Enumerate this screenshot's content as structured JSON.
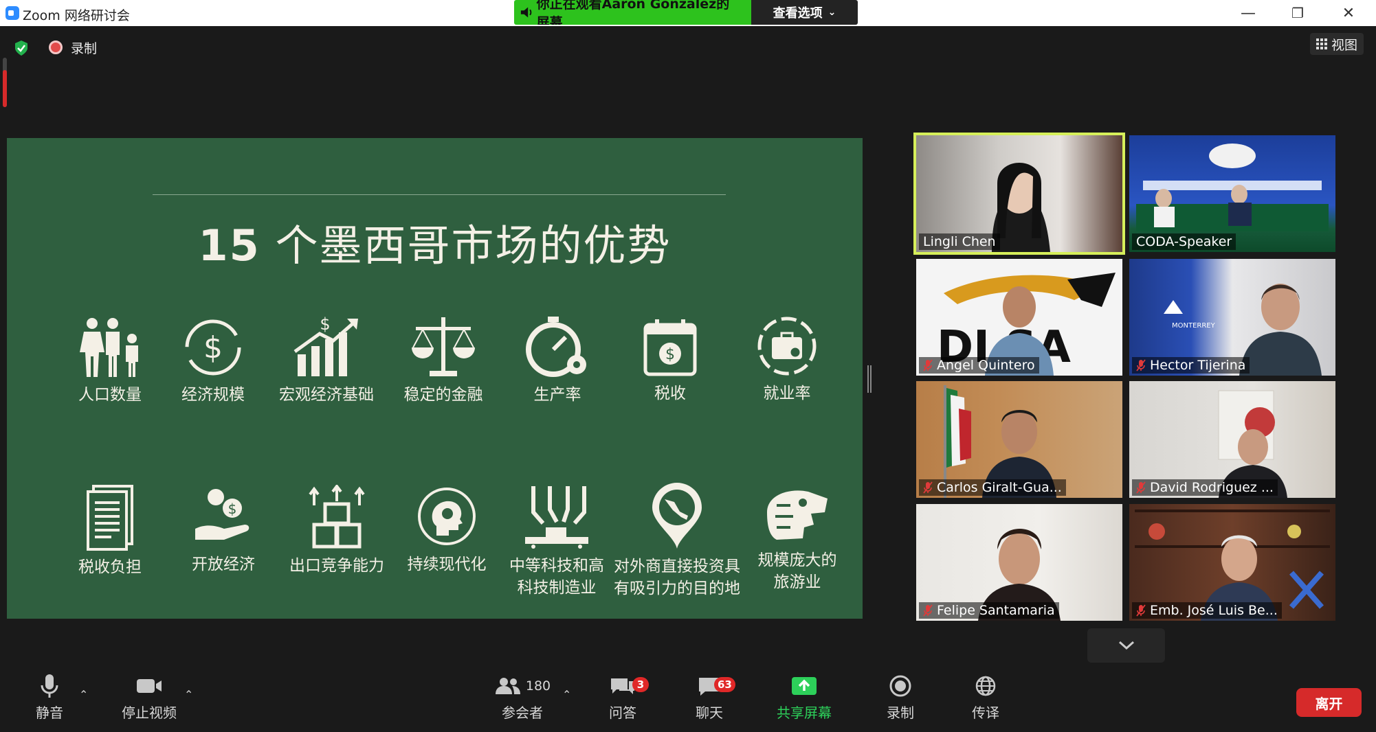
{
  "window": {
    "title": "Zoom 网络研讨会",
    "share_banner_text": "你正在观看Aaron Gonzalez的屏幕",
    "view_options_label": "查看选项",
    "minimize": "—",
    "restore": "❐",
    "close": "✕"
  },
  "meeting_bar": {
    "recording_label": "录制",
    "view_label": "视图"
  },
  "slide": {
    "title_number": "15",
    "title_text": " 个墨西哥市场的优势",
    "row1": [
      {
        "label": "人口数量",
        "icon": "population-icon"
      },
      {
        "label": "经济规模",
        "icon": "dollar-cycle-icon"
      },
      {
        "label": "宏观经济基础",
        "icon": "growth-chart-icon"
      },
      {
        "label": "稳定的金融",
        "icon": "balance-scale-icon"
      },
      {
        "label": "生产率",
        "icon": "stopwatch-gear-icon"
      },
      {
        "label": "税收",
        "icon": "tax-calendar-icon"
      },
      {
        "label": "就业率",
        "icon": "briefcase-search-icon"
      }
    ],
    "row2": [
      {
        "label": "税收负担",
        "icon": "documents-icon"
      },
      {
        "label": "开放经济",
        "icon": "hand-coins-icon"
      },
      {
        "label": "出口竞争能力",
        "icon": "boxes-export-icon"
      },
      {
        "label": "持续现代化",
        "icon": "head-idea-icon"
      },
      {
        "label": "中等科技和高\n科技制造业",
        "icon": "robot-arms-icon"
      },
      {
        "label": "对外商直接投资具\n有吸引力的目的地",
        "icon": "mexico-pin-icon"
      },
      {
        "label": "规模庞大的\n旅游业",
        "icon": "aztec-serpent-icon"
      }
    ]
  },
  "participants": [
    {
      "name": "Lingli Chen",
      "muted": false,
      "active": true
    },
    {
      "name": "CODA-Speaker",
      "muted": false,
      "active": false
    },
    {
      "name": "Angel Quintero",
      "muted": true,
      "active": false
    },
    {
      "name": "Hector Tijerina",
      "muted": true,
      "active": false
    },
    {
      "name": "Carlos Giralt-Gua...",
      "muted": true,
      "active": false
    },
    {
      "name": "David Rodriguez ...",
      "muted": true,
      "active": false
    },
    {
      "name": "Felipe Santamaria",
      "muted": true,
      "active": false
    },
    {
      "name": "Emb. José Luis Be...",
      "muted": true,
      "active": false
    }
  ],
  "toolbar": {
    "mute_label": "静音",
    "stop_video_label": "停止视频",
    "participants_label": "参会者",
    "participants_count": "180",
    "qa_label": "问答",
    "qa_badge": "3",
    "chat_label": "聊天",
    "chat_badge": "63",
    "share_label": "共享屏幕",
    "record_label": "录制",
    "interpret_label": "传译",
    "leave_label": "离开"
  },
  "colors": {
    "slide_bg": "#2f5f3f",
    "share_green": "#2dc21d",
    "active_speaker": "#d6ef5a",
    "leave_red": "#d62a2a",
    "badge_red": "#e02828"
  }
}
